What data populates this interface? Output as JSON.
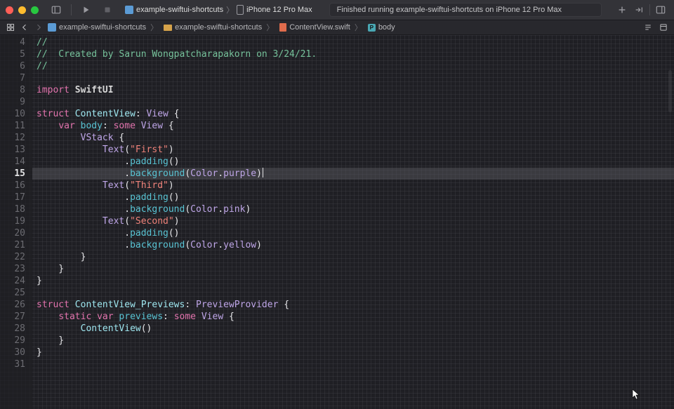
{
  "toolbar": {
    "scheme_target": "example-swiftui-shortcuts",
    "scheme_device": "iPhone 12 Pro Max",
    "status": "Finished running example-swiftui-shortcuts on iPhone 12 Pro Max"
  },
  "breadcrumbs": {
    "items": [
      {
        "icon": "project",
        "label": "example-swiftui-shortcuts"
      },
      {
        "icon": "folder",
        "label": "example-swiftui-shortcuts"
      },
      {
        "icon": "swift",
        "label": "ContentView.swift"
      },
      {
        "icon": "property",
        "label": "body"
      }
    ]
  },
  "editor": {
    "highlighted_line": 15,
    "lines": [
      {
        "n": 4,
        "tokens": [
          {
            "t": "//",
            "c": "comment"
          }
        ]
      },
      {
        "n": 5,
        "tokens": [
          {
            "t": "//  Created by Sarun Wongpatcharapakorn on 3/24/21.",
            "c": "comment"
          }
        ]
      },
      {
        "n": 6,
        "tokens": [
          {
            "t": "//",
            "c": "comment"
          }
        ]
      },
      {
        "n": 7,
        "tokens": []
      },
      {
        "n": 8,
        "tokens": [
          {
            "t": "import",
            "c": "kw"
          },
          {
            "t": " ",
            "c": "plain"
          },
          {
            "t": "SwiftUI",
            "c": "import"
          }
        ]
      },
      {
        "n": 9,
        "tokens": []
      },
      {
        "n": 10,
        "tokens": [
          {
            "t": "struct",
            "c": "kw"
          },
          {
            "t": " ",
            "c": "plain"
          },
          {
            "t": "ContentView",
            "c": "type"
          },
          {
            "t": ": ",
            "c": "plain"
          },
          {
            "t": "View",
            "c": "typedk"
          },
          {
            "t": " {",
            "c": "plain"
          }
        ]
      },
      {
        "n": 11,
        "tokens": [
          {
            "t": "    ",
            "c": "plain"
          },
          {
            "t": "var",
            "c": "kw"
          },
          {
            "t": " ",
            "c": "plain"
          },
          {
            "t": "body",
            "c": "ident"
          },
          {
            "t": ": ",
            "c": "plain"
          },
          {
            "t": "some",
            "c": "kw"
          },
          {
            "t": " ",
            "c": "plain"
          },
          {
            "t": "View",
            "c": "typedk"
          },
          {
            "t": " {",
            "c": "plain"
          }
        ]
      },
      {
        "n": 12,
        "tokens": [
          {
            "t": "        ",
            "c": "plain"
          },
          {
            "t": "VStack",
            "c": "typedk"
          },
          {
            "t": " {",
            "c": "plain"
          }
        ]
      },
      {
        "n": 13,
        "tokens": [
          {
            "t": "            ",
            "c": "plain"
          },
          {
            "t": "Text",
            "c": "typedk"
          },
          {
            "t": "(",
            "c": "plain"
          },
          {
            "t": "\"First\"",
            "c": "str"
          },
          {
            "t": ")",
            "c": "plain"
          }
        ]
      },
      {
        "n": 14,
        "tokens": [
          {
            "t": "                .",
            "c": "plain"
          },
          {
            "t": "padding",
            "c": "ident"
          },
          {
            "t": "()",
            "c": "plain"
          }
        ]
      },
      {
        "n": 15,
        "tokens": [
          {
            "t": "                .",
            "c": "plain"
          },
          {
            "t": "background",
            "c": "ident"
          },
          {
            "t": "(",
            "c": "plain"
          },
          {
            "t": "Color",
            "c": "typedk"
          },
          {
            "t": ".",
            "c": "plain"
          },
          {
            "t": "purple",
            "c": "typedk"
          },
          {
            "t": ")",
            "c": "plain"
          }
        ]
      },
      {
        "n": 16,
        "tokens": [
          {
            "t": "            ",
            "c": "plain"
          },
          {
            "t": "Text",
            "c": "typedk"
          },
          {
            "t": "(",
            "c": "plain"
          },
          {
            "t": "\"Third\"",
            "c": "str"
          },
          {
            "t": ")",
            "c": "plain"
          }
        ]
      },
      {
        "n": 17,
        "tokens": [
          {
            "t": "                .",
            "c": "plain"
          },
          {
            "t": "padding",
            "c": "ident"
          },
          {
            "t": "()",
            "c": "plain"
          }
        ]
      },
      {
        "n": 18,
        "tokens": [
          {
            "t": "                .",
            "c": "plain"
          },
          {
            "t": "background",
            "c": "ident"
          },
          {
            "t": "(",
            "c": "plain"
          },
          {
            "t": "Color",
            "c": "typedk"
          },
          {
            "t": ".",
            "c": "plain"
          },
          {
            "t": "pink",
            "c": "typedk"
          },
          {
            "t": ")",
            "c": "plain"
          }
        ]
      },
      {
        "n": 19,
        "tokens": [
          {
            "t": "            ",
            "c": "plain"
          },
          {
            "t": "Text",
            "c": "typedk"
          },
          {
            "t": "(",
            "c": "plain"
          },
          {
            "t": "\"Second\"",
            "c": "str"
          },
          {
            "t": ")",
            "c": "plain"
          }
        ]
      },
      {
        "n": 20,
        "tokens": [
          {
            "t": "                .",
            "c": "plain"
          },
          {
            "t": "padding",
            "c": "ident"
          },
          {
            "t": "()",
            "c": "plain"
          }
        ]
      },
      {
        "n": 21,
        "tokens": [
          {
            "t": "                .",
            "c": "plain"
          },
          {
            "t": "background",
            "c": "ident"
          },
          {
            "t": "(",
            "c": "plain"
          },
          {
            "t": "Color",
            "c": "typedk"
          },
          {
            "t": ".",
            "c": "plain"
          },
          {
            "t": "yellow",
            "c": "typedk"
          },
          {
            "t": ")",
            "c": "plain"
          }
        ]
      },
      {
        "n": 22,
        "tokens": [
          {
            "t": "        }",
            "c": "plain"
          }
        ]
      },
      {
        "n": 23,
        "tokens": [
          {
            "t": "    }",
            "c": "plain"
          }
        ]
      },
      {
        "n": 24,
        "tokens": [
          {
            "t": "}",
            "c": "plain"
          }
        ]
      },
      {
        "n": 25,
        "tokens": []
      },
      {
        "n": 26,
        "tokens": [
          {
            "t": "struct",
            "c": "kw"
          },
          {
            "t": " ",
            "c": "plain"
          },
          {
            "t": "ContentView_Previews",
            "c": "type"
          },
          {
            "t": ": ",
            "c": "plain"
          },
          {
            "t": "PreviewProvider",
            "c": "typedk"
          },
          {
            "t": " {",
            "c": "plain"
          }
        ]
      },
      {
        "n": 27,
        "tokens": [
          {
            "t": "    ",
            "c": "plain"
          },
          {
            "t": "static",
            "c": "kw"
          },
          {
            "t": " ",
            "c": "plain"
          },
          {
            "t": "var",
            "c": "kw"
          },
          {
            "t": " ",
            "c": "plain"
          },
          {
            "t": "previews",
            "c": "ident"
          },
          {
            "t": ": ",
            "c": "plain"
          },
          {
            "t": "some",
            "c": "kw"
          },
          {
            "t": " ",
            "c": "plain"
          },
          {
            "t": "View",
            "c": "typedk"
          },
          {
            "t": " {",
            "c": "plain"
          }
        ]
      },
      {
        "n": 28,
        "tokens": [
          {
            "t": "        ",
            "c": "plain"
          },
          {
            "t": "ContentView",
            "c": "type"
          },
          {
            "t": "()",
            "c": "plain"
          }
        ]
      },
      {
        "n": 29,
        "tokens": [
          {
            "t": "    }",
            "c": "plain"
          }
        ]
      },
      {
        "n": 30,
        "tokens": [
          {
            "t": "}",
            "c": "plain"
          }
        ]
      },
      {
        "n": 31,
        "tokens": []
      }
    ]
  }
}
